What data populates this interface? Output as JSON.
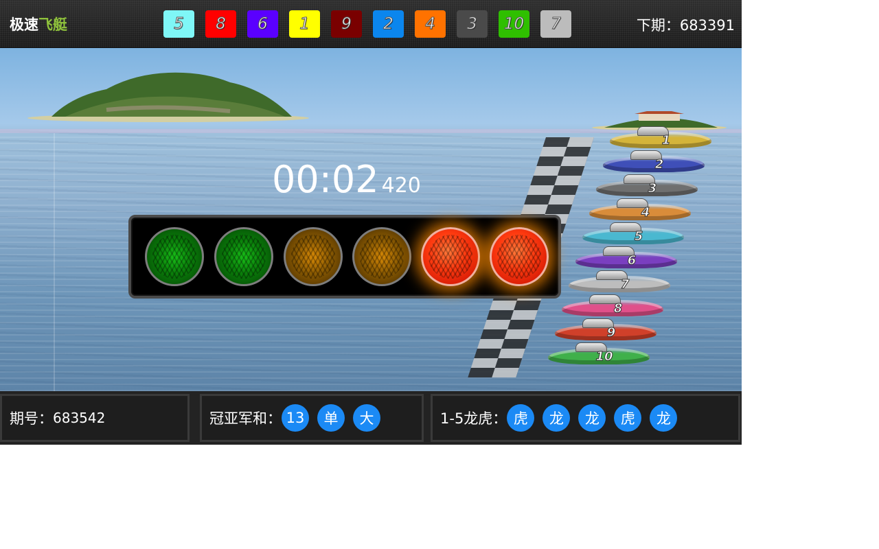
{
  "header": {
    "logo_main": "极速",
    "logo_accent": "飞艇",
    "next_label": "下期：",
    "next_period": "683391",
    "results": [
      {
        "number": "5",
        "color": "#7ff7f7"
      },
      {
        "number": "8",
        "color": "#ff0000"
      },
      {
        "number": "6",
        "color": "#5a00ff"
      },
      {
        "number": "1",
        "color": "#ffff00"
      },
      {
        "number": "9",
        "color": "#7a0000"
      },
      {
        "number": "2",
        "color": "#0b86ee"
      },
      {
        "number": "4",
        "color": "#ff7200"
      },
      {
        "number": "3",
        "color": "#4a4a4a"
      },
      {
        "number": "10",
        "color": "#2fbf00"
      },
      {
        "number": "7",
        "color": "#bcbcbc"
      }
    ]
  },
  "scene": {
    "timer_main": "00:02",
    "timer_ms": "420",
    "lights": [
      {
        "color": "green",
        "lit": false
      },
      {
        "color": "green",
        "lit": false
      },
      {
        "color": "amber",
        "lit": false
      },
      {
        "color": "amber",
        "lit": false
      },
      {
        "color": "red",
        "lit": true
      },
      {
        "color": "red",
        "lit": true
      }
    ],
    "boats": [
      {
        "number": "1",
        "color": "#d4b43a"
      },
      {
        "number": "2",
        "color": "#3f4fb8"
      },
      {
        "number": "3",
        "color": "#6f6f6f"
      },
      {
        "number": "4",
        "color": "#d98c3a"
      },
      {
        "number": "5",
        "color": "#4ab8d0"
      },
      {
        "number": "6",
        "color": "#7a3fc0"
      },
      {
        "number": "7",
        "color": "#bdbdbd"
      },
      {
        "number": "8",
        "color": "#e0508a"
      },
      {
        "number": "9",
        "color": "#d0402a"
      },
      {
        "number": "10",
        "color": "#3fb04a"
      }
    ]
  },
  "bottom": {
    "period_label": "期号：",
    "period_value": "683542",
    "sum_label": "冠亚军和：",
    "sum_chips": [
      "13",
      "单",
      "大"
    ],
    "dragon_tiger_label": "1-5龙虎：",
    "dragon_tiger_chips": [
      "虎",
      "龙",
      "龙",
      "虎",
      "龙"
    ]
  }
}
